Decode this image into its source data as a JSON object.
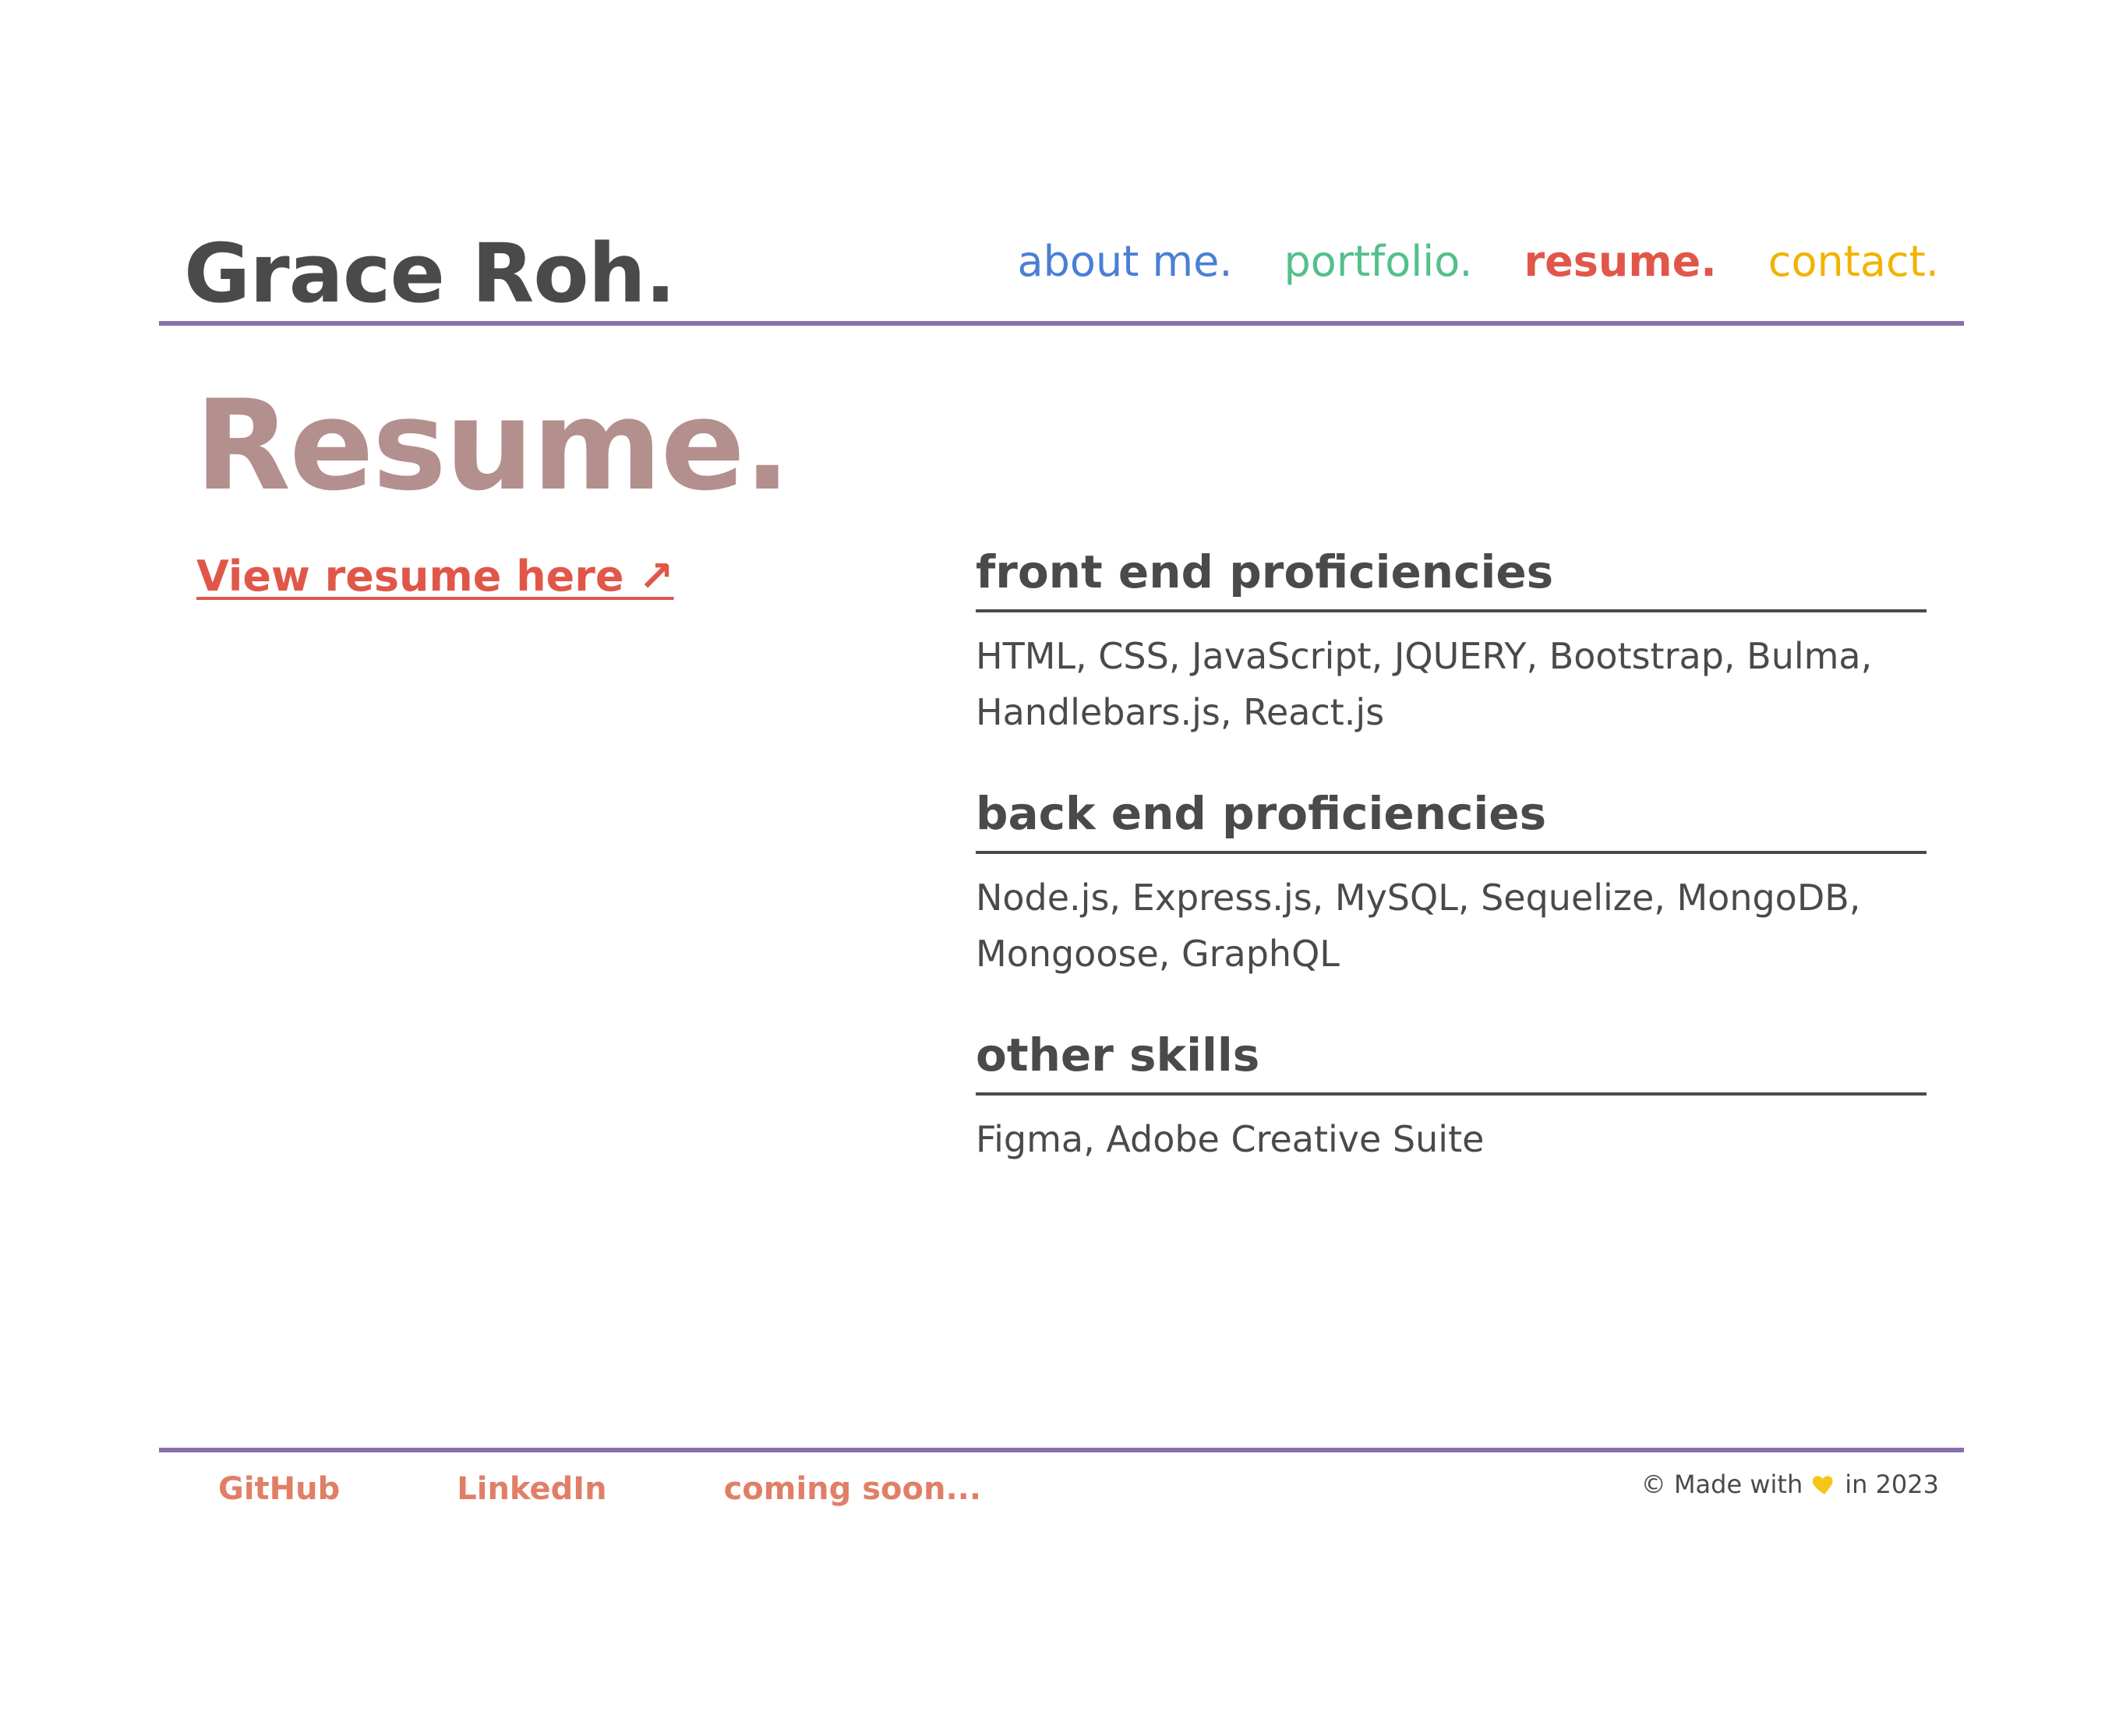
{
  "header": {
    "site_title": "Grace Roh.",
    "nav": [
      {
        "label": "about me.",
        "color": "#4a7fd4"
      },
      {
        "label": "portfolio.",
        "color": "#52c08a"
      },
      {
        "label": "resume.",
        "color": "#e0574a",
        "active": true
      },
      {
        "label": "contact.",
        "color": "#f0b400"
      }
    ]
  },
  "colors": {
    "divider": "#8a6fae",
    "heading": "#b38f8d",
    "text": "#4a4a4a",
    "link": "#e0574a",
    "footer_link": "#e07f66",
    "heart": "#f5c518"
  },
  "main": {
    "page_heading": "Resume.",
    "resume_link_label": "View resume here ↗",
    "skills": [
      {
        "title": "front end proficiencies",
        "items": "HTML, CSS, JavaScript, JQUERY, Bootstrap, Bulma, Handlebars.js, React.js"
      },
      {
        "title": "back end proficiencies",
        "items": "Node.js, Express.js, MySQL, Sequelize, MongoDB, Mongoose, GraphQL"
      },
      {
        "title": "other skills",
        "items": "Figma, Adobe Creative Suite"
      }
    ]
  },
  "footer": {
    "links": [
      "GitHub",
      "LinkedIn",
      "coming soon..."
    ],
    "credit_prefix": "© Made with",
    "credit_icon": "heart-icon",
    "credit_suffix": "in 2023"
  }
}
